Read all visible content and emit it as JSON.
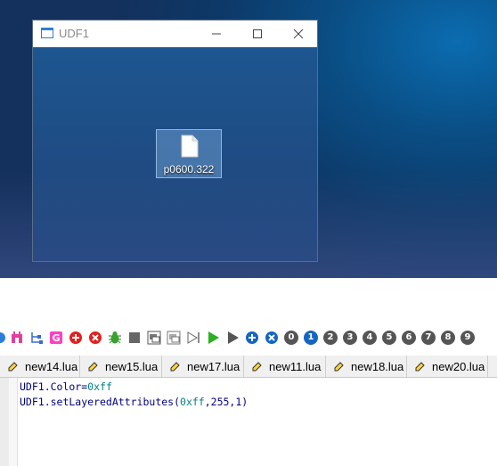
{
  "window": {
    "title": "UDF1",
    "minimize_glyph": "—",
    "maximize_glyph": "☐",
    "close_glyph": "✕"
  },
  "desktop_file": {
    "label": "p0600.322",
    "icon": "file-icon"
  },
  "toolbar": {
    "number_buttons": [
      "0",
      "1",
      "2",
      "3",
      "4",
      "5",
      "6",
      "7",
      "8",
      "9"
    ],
    "icons": [
      "arrow-icon",
      "pink-tool-icon",
      "tree-icon",
      "pink-g-icon",
      "add-red-icon",
      "remove-red-icon",
      "bug-icon",
      "stop-icon",
      "window-capture-icon",
      "window-capture2-icon",
      "step-icon",
      "run-green-icon",
      "run-gray-icon",
      "add-blue-icon",
      "remove-blue-icon"
    ]
  },
  "tabs": [
    {
      "label": "new14.lua"
    },
    {
      "label": "new15.lua"
    },
    {
      "label": "new17.lua"
    },
    {
      "label": "new11.lua"
    },
    {
      "label": "new18.lua"
    },
    {
      "label": "new20.lua"
    }
  ],
  "editor": {
    "line1": {
      "prefix": "UDF1.Color=",
      "value": "0xff"
    },
    "line2": {
      "prefix": "UDF1.setLayeredAttributes(",
      "value": "0xff",
      "rest": ",255,1)"
    }
  },
  "colors": {
    "accent_blue": "#1565c0",
    "code_text": "#000080",
    "code_number": "#008080"
  }
}
